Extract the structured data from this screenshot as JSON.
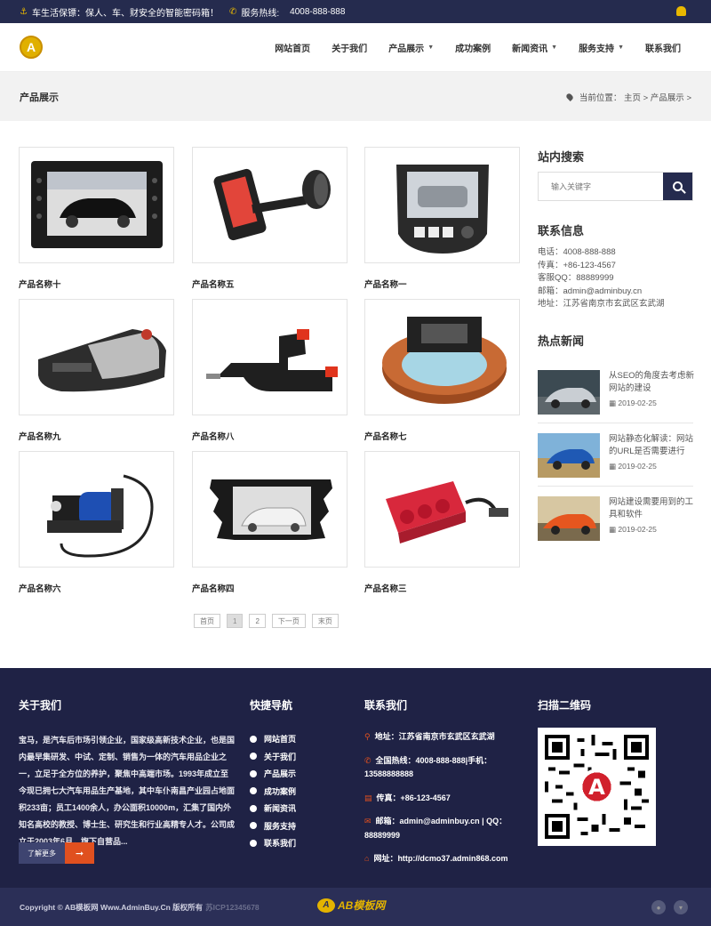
{
  "topbar": {
    "slogan": "车生活保镖：保人、车、财安全的智能密码箱！",
    "hotline_label": "服务热线:",
    "hotline": "4008-888-888"
  },
  "nav": {
    "items": [
      {
        "label": "网站首页",
        "dropdown": false
      },
      {
        "label": "关于我们",
        "dropdown": false
      },
      {
        "label": "产品展示",
        "dropdown": true
      },
      {
        "label": "成功案例",
        "dropdown": false
      },
      {
        "label": "新闻资讯",
        "dropdown": true
      },
      {
        "label": "服务支持",
        "dropdown": true
      },
      {
        "label": "联系我们",
        "dropdown": false
      }
    ]
  },
  "banner": {
    "title": "产品展示",
    "crumb": "当前位置：  主页 > 产品展示 >"
  },
  "products": [
    {
      "name": "产品名称十",
      "img": "car-dvd-nav"
    },
    {
      "name": "产品名称五",
      "img": "phone-holder"
    },
    {
      "name": "产品名称一",
      "img": "dash-unit-van"
    },
    {
      "name": "产品名称九",
      "img": "radar-detector"
    },
    {
      "name": "产品名称八",
      "img": "usb-charger"
    },
    {
      "name": "产品名称七",
      "img": "round-console"
    },
    {
      "name": "产品名称六",
      "img": "air-compressor"
    },
    {
      "name": "产品名称四",
      "img": "car-dvd-sedan"
    },
    {
      "name": "产品名称三",
      "img": "socket-splitter"
    }
  ],
  "pager": [
    "首页",
    "1",
    "2",
    "下一页",
    "末页"
  ],
  "pager_active": "1",
  "sidebar": {
    "search_title": "站内搜索",
    "search_placeholder": "输入关键字",
    "contact_title": "联系信息",
    "contact": [
      "电话：4008-888-888",
      "传真：+86-123-4567",
      "客服QQ：88889999",
      "邮箱：admin@adminbuy.cn",
      "地址：江苏省南京市玄武区玄武湖"
    ],
    "news_title": "热点新闻",
    "news": [
      {
        "title": "从SEO的角度去考虑新网站的建设",
        "date": "2019-02-25"
      },
      {
        "title": "网站静态化解读：网站的URL是否需要进行",
        "date": "2019-02-25"
      },
      {
        "title": "网站建设需要用到的工具和软件",
        "date": "2019-02-25"
      }
    ]
  },
  "footer": {
    "about_title": "关于我们",
    "about_text": "宝马，是汽车后市场引领企业，国家级高新技术企业，也是国内最早集研发、中试、定制、销售为一体的汽车用品企业之一，立足于全方位的养护，聚焦中高端市场。1993年成立至今现已拥七大汽车用品生产基地，其中车仆南昌产业园占地面积233亩；员工1400余人，办公面积10000m，汇集了国内外知名高校的教授、博士生、研究生和行业高精专人才。公司成立于2003年6月，旗下自营品...",
    "more_label": "了解更多",
    "quick_title": "快捷导航",
    "quick": [
      "网站首页",
      "关于我们",
      "产品展示",
      "成功案例",
      "新闻资讯",
      "服务支持",
      "联系我们"
    ],
    "contact_title": "联系我们",
    "contact": [
      {
        "icon": "map-pin-icon",
        "text": "地址：江苏省南京市玄武区玄武湖"
      },
      {
        "icon": "phone-icon",
        "text": "全国热线：4008-888-888|手机：13588888888"
      },
      {
        "icon": "fax-icon",
        "text": "传真：+86-123-4567"
      },
      {
        "icon": "mail-icon",
        "text": "邮箱：admin@adminbuy.cn | QQ：88889999"
      },
      {
        "icon": "home-icon",
        "text": "网址：http://dcmo37.admin868.com"
      }
    ],
    "qr_title": "扫描二维码"
  },
  "copyright": {
    "text": "Copyright © AB模板网 Www.AdminBuy.Cn 版权所有",
    "icp": "苏ICP12345678",
    "logo_text": "AB模板网"
  },
  "colors": {
    "navy": "#252b4e",
    "accent": "#e0501f",
    "gold": "#e9b800"
  }
}
